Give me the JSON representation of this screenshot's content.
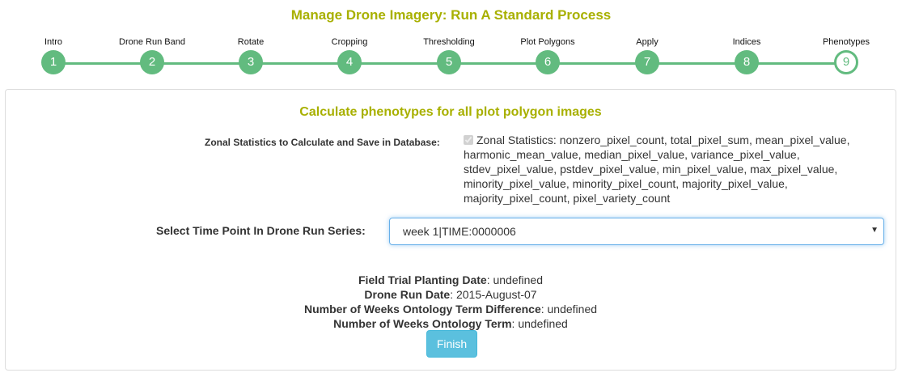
{
  "title": "Manage Drone Imagery: Run A Standard Process",
  "steps": [
    {
      "label": "Intro",
      "num": "1"
    },
    {
      "label": "Drone Run Band",
      "num": "2"
    },
    {
      "label": "Rotate",
      "num": "3"
    },
    {
      "label": "Cropping",
      "num": "4"
    },
    {
      "label": "Thresholding",
      "num": "5"
    },
    {
      "label": "Plot Polygons",
      "num": "6"
    },
    {
      "label": "Apply",
      "num": "7"
    },
    {
      "label": "Indices",
      "num": "8"
    },
    {
      "label": "Phenotypes",
      "num": "9"
    }
  ],
  "current_step": 9,
  "panel": {
    "subtitle": "Calculate phenotypes for all plot polygon images",
    "zonal_label": "Zonal Statistics to Calculate and Save in Database:",
    "zonal_checked": true,
    "zonal_text": "Zonal Statistics: nonzero_pixel_count, total_pixel_sum, mean_pixel_value, harmonic_mean_value, median_pixel_value, variance_pixel_value, stdev_pixel_value, pstdev_pixel_value, min_pixel_value, max_pixel_value, minority_pixel_value, minority_pixel_count, majority_pixel_value, majority_pixel_count, pixel_variety_count",
    "time_label": "Select Time Point In Drone Run Series:",
    "time_value": "week 1|TIME:0000006",
    "info": [
      {
        "k": "Field Trial Planting Date",
        "v": ": undefined"
      },
      {
        "k": "Drone Run Date",
        "v": ": 2015-August-07"
      },
      {
        "k": "Number of Weeks Ontology Term Difference",
        "v": ": undefined"
      },
      {
        "k": "Number of Weeks Ontology Term",
        "v": ": undefined"
      }
    ],
    "finish": "Finish"
  },
  "colors": {
    "accent": "#a8b000",
    "step": "#62bb7f",
    "button": "#5bc0de"
  }
}
